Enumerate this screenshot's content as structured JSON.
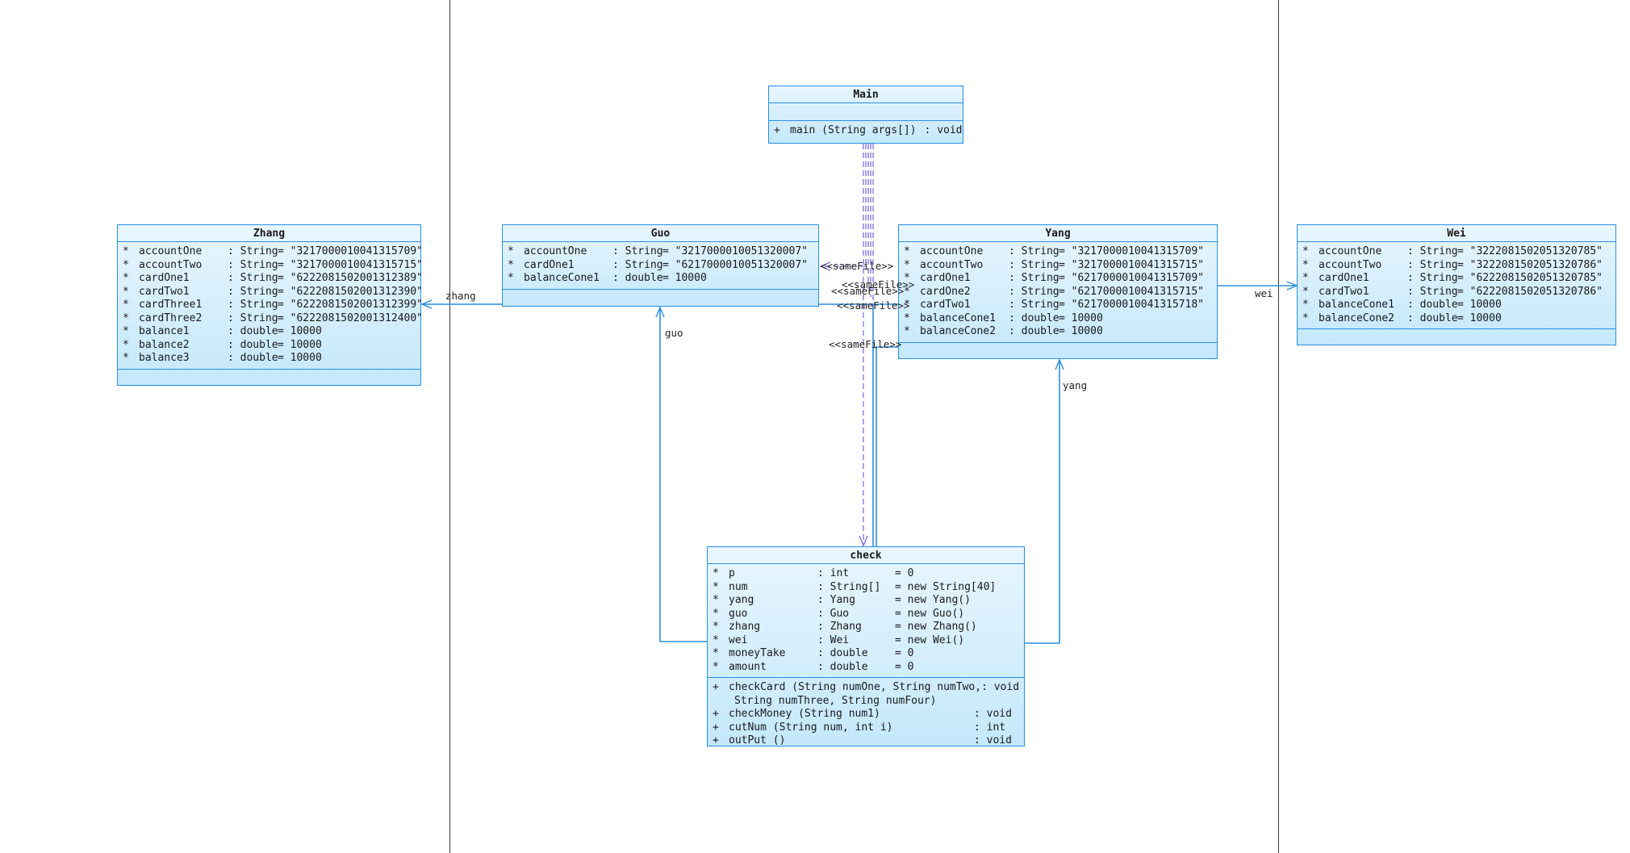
{
  "colors": {
    "border": "#2a8fe0",
    "fill_top": "#e8f6fe",
    "fill_bottom": "#c4e8fb",
    "dependency": "#7b6fe0",
    "divider": "#3a3a3a"
  },
  "classes": {
    "main": {
      "name": "Main",
      "attributes": [],
      "operations": [
        {
          "vis": "+",
          "sig": "main (String args[])",
          "ret": ": void"
        }
      ]
    },
    "zhang": {
      "name": "Zhang",
      "attributes": [
        {
          "vis": "*",
          "name": "accountOne",
          "type": ": String",
          "def": "= \"3217000010041315709\""
        },
        {
          "vis": "*",
          "name": "accountTwo",
          "type": ": String",
          "def": "= \"3217000010041315715\""
        },
        {
          "vis": "*",
          "name": "cardOne1",
          "type": ": String",
          "def": "= \"6222081502001312389\""
        },
        {
          "vis": "*",
          "name": "cardTwo1",
          "type": ": String",
          "def": "= \"6222081502001312390\""
        },
        {
          "vis": "*",
          "name": "cardThree1",
          "type": ": String",
          "def": "= \"6222081502001312399\""
        },
        {
          "vis": "*",
          "name": "cardThree2",
          "type": ": String",
          "def": "= \"6222081502001312400\""
        },
        {
          "vis": "*",
          "name": "balance1",
          "type": ": double",
          "def": "= 10000"
        },
        {
          "vis": "*",
          "name": "balance2",
          "type": ": double",
          "def": "= 10000"
        },
        {
          "vis": "*",
          "name": "balance3",
          "type": ": double",
          "def": "= 10000"
        }
      ],
      "operations": []
    },
    "guo": {
      "name": "Guo",
      "attributes": [
        {
          "vis": "*",
          "name": "accountOne",
          "type": ": String",
          "def": "= \"3217000010051320007\""
        },
        {
          "vis": "*",
          "name": "cardOne1",
          "type": ": String",
          "def": "= \"6217000010051320007\""
        },
        {
          "vis": "*",
          "name": "balanceCone1",
          "type": ": double",
          "def": "= 10000"
        }
      ],
      "operations": []
    },
    "yang": {
      "name": "Yang",
      "attributes": [
        {
          "vis": "*",
          "name": "accountOne",
          "type": ": String",
          "def": "= \"3217000010041315709\""
        },
        {
          "vis": "*",
          "name": "accountTwo",
          "type": ": String",
          "def": "= \"3217000010041315715\""
        },
        {
          "vis": "*",
          "name": "cardOne1",
          "type": ": String",
          "def": "= \"6217000010041315709\""
        },
        {
          "vis": "*",
          "name": "cardOne2",
          "type": ": String",
          "def": "= \"6217000010041315715\""
        },
        {
          "vis": "*",
          "name": "cardTwo1",
          "type": ": String",
          "def": "= \"6217000010041315718\""
        },
        {
          "vis": "*",
          "name": "balanceCone1",
          "type": ": double",
          "def": "= 10000"
        },
        {
          "vis": "*",
          "name": "balanceCone2",
          "type": ": double",
          "def": "= 10000"
        }
      ],
      "operations": []
    },
    "wei": {
      "name": "Wei",
      "attributes": [
        {
          "vis": "*",
          "name": "accountOne",
          "type": ": String",
          "def": "= \"3222081502051320785\""
        },
        {
          "vis": "*",
          "name": "accountTwo",
          "type": ": String",
          "def": "= \"3222081502051320786\""
        },
        {
          "vis": "*",
          "name": "cardOne1",
          "type": ": String",
          "def": "= \"6222081502051320785\""
        },
        {
          "vis": "*",
          "name": "cardTwo1",
          "type": ": String",
          "def": "= \"6222081502051320786\""
        },
        {
          "vis": "*",
          "name": "balanceCone1",
          "type": ": double",
          "def": "= 10000"
        },
        {
          "vis": "*",
          "name": "balanceCone2",
          "type": ": double",
          "def": "= 10000"
        }
      ],
      "operations": []
    },
    "check": {
      "name": "check",
      "attributes": [
        {
          "vis": "*",
          "name": "p",
          "type": ": int",
          "def": "= 0"
        },
        {
          "vis": "*",
          "name": "num",
          "type": ": String[]",
          "def": "= new String[40]"
        },
        {
          "vis": "*",
          "name": "yang",
          "type": ": Yang",
          "def": "= new Yang()"
        },
        {
          "vis": "*",
          "name": "guo",
          "type": ": Guo",
          "def": "= new Guo()"
        },
        {
          "vis": "*",
          "name": "zhang",
          "type": ": Zhang",
          "def": "= new Zhang()"
        },
        {
          "vis": "*",
          "name": "wei",
          "type": ": Wei",
          "def": "= new Wei()"
        },
        {
          "vis": "*",
          "name": "moneyTake",
          "type": ": double",
          "def": "= 0"
        },
        {
          "vis": "*",
          "name": "amount",
          "type": ": double",
          "def": "= 0"
        }
      ],
      "operations": [
        {
          "vis": "+",
          "sig": "checkCard (String numOne, String numTwo,",
          "sig2": "String numThree, String numFour)",
          "ret": ": void"
        },
        {
          "vis": "+",
          "sig": "checkMoney (String num1)",
          "ret": ": void"
        },
        {
          "vis": "+",
          "sig": "cutNum (String num, int i)",
          "ret": ": int"
        },
        {
          "vis": "+",
          "sig": "outPut ()",
          "ret": ": void"
        }
      ]
    }
  },
  "labels": {
    "zhang": "zhang",
    "guo": "guo",
    "yang": "yang",
    "wei": "wei",
    "samefile_1": "<<sameFile>>",
    "samefile_2": "<<sameFile>>",
    "samefile_3": "<<sameFile>>",
    "samefile_4": "<<sameFile>>",
    "samefile_5": "<<sameFile>>"
  }
}
